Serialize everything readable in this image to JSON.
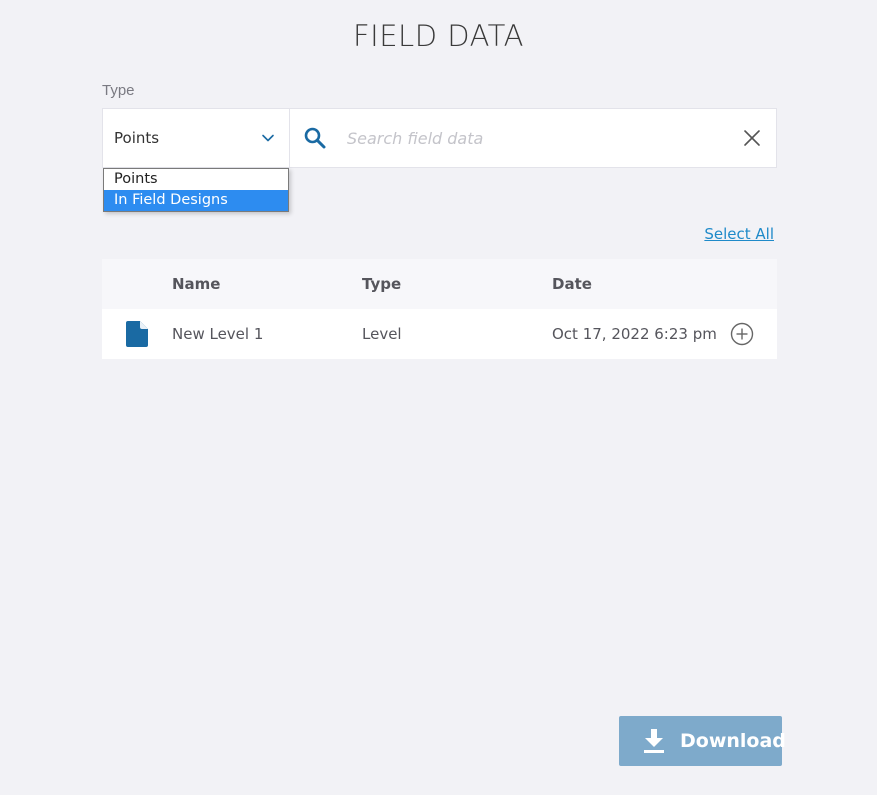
{
  "page": {
    "title": "FIELD DATA"
  },
  "filter": {
    "type_label": "Type",
    "type_value": "Points",
    "options": [
      "Points",
      "In Field Designs"
    ],
    "highlighted_option": "In Field Designs",
    "search_placeholder": "Search field data",
    "search_value": ""
  },
  "table": {
    "select_all_label": "Select All",
    "columns": [
      "Name",
      "Type",
      "Date"
    ],
    "rows": [
      {
        "name": "New Level 1",
        "type": "Level",
        "date": "Oct 17, 2022 6:23 pm"
      }
    ]
  },
  "footer": {
    "download_label": "Download"
  },
  "icons": {
    "chevron": "chevron-down-icon",
    "search": "search-icon",
    "clear": "close-icon",
    "file": "file-icon",
    "add": "add-circle-icon",
    "download": "download-icon"
  },
  "colors": {
    "accent": "#1f8ac9",
    "icon_blue": "#1a6aa3",
    "selected_option": "#2d8cf0",
    "download_button": "#7eaacb",
    "background": "#f2f2f6"
  }
}
